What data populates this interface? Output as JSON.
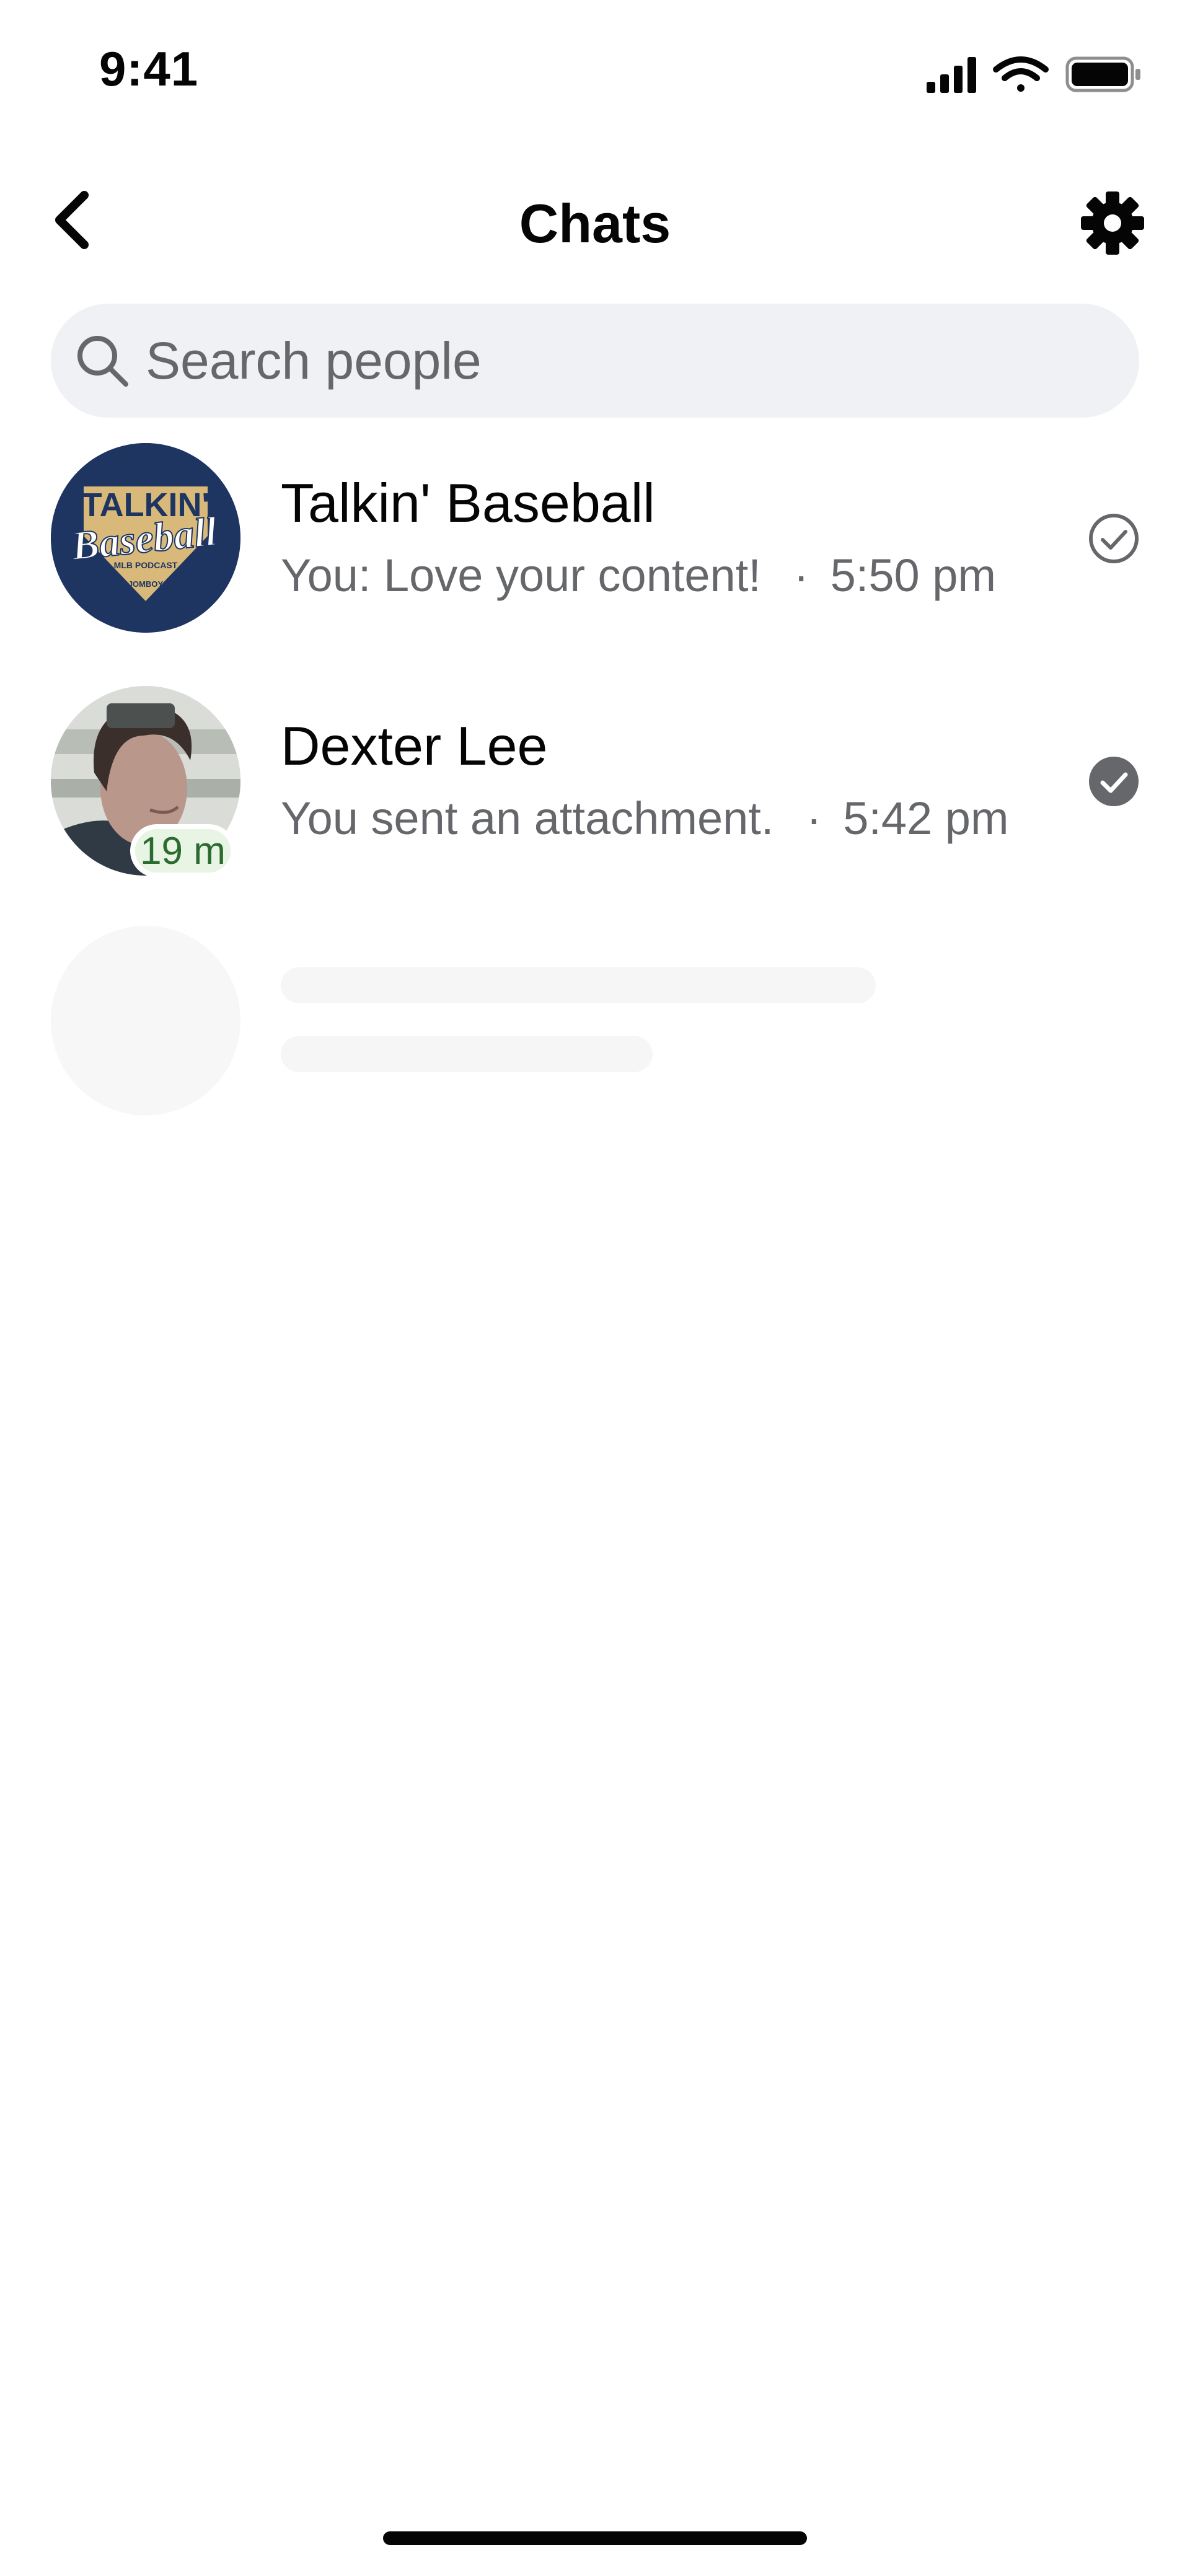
{
  "status_bar": {
    "time": "9:41",
    "icons": [
      "cellular-signal-icon",
      "wifi-icon",
      "battery-icon"
    ]
  },
  "header": {
    "title": "Chats",
    "back_icon": "chevron-left-icon",
    "settings_icon": "gear-icon"
  },
  "search": {
    "placeholder": "Search people",
    "value": "",
    "icon": "search-icon"
  },
  "chats": [
    {
      "name": "Talkin' Baseball",
      "preview": "You: Love your content!",
      "separator": "·",
      "time": "5:50 pm",
      "status": "sent",
      "avatar_text": [
        "TALKIN'",
        "Baseball",
        "MLB PODCAST",
        "JOMBOY"
      ]
    },
    {
      "name": "Dexter Lee",
      "preview": "You sent an attachment.",
      "separator": "·",
      "time": "5:42 pm",
      "status": "delivered",
      "active_badge": "19 m"
    }
  ],
  "colors": {
    "text_primary": "#050505",
    "text_secondary": "#65676b",
    "search_bg": "#f0f1f4",
    "badge_bg": "#e8f4e4",
    "badge_text": "#2c6b2f",
    "avatar_navy": "#1f3561",
    "avatar_gold": "#d8b97a"
  }
}
